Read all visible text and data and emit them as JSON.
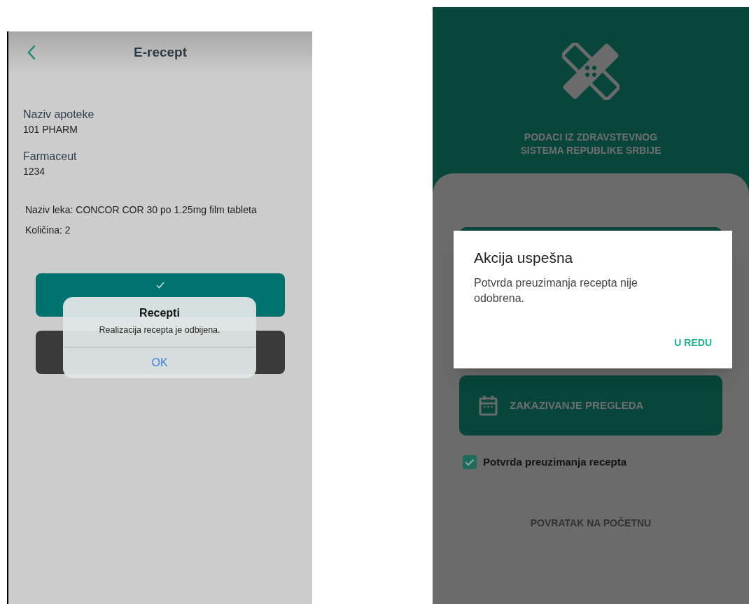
{
  "left_screen": {
    "header": {
      "title": "E-recept"
    },
    "fields": [
      {
        "label": "Naziv apoteke",
        "value": "101 PHARM"
      },
      {
        "label": "Farmaceut",
        "value": "1234"
      }
    ],
    "medication": [
      "Naziv leka: CONCOR COR 30 po 1.25mg film tableta",
      "Količina: 2"
    ],
    "buttons": [
      {
        "kind": "primary"
      },
      {
        "kind": "secondary"
      }
    ],
    "alert": {
      "title": "Recepti",
      "message": "Realizacija recepta je odbijena.",
      "button": "OK"
    }
  },
  "right_screen": {
    "header_text": "PODACI IZ ZDRAVSTEVNOG SISTEMA REPUBLIKE SRBIJE",
    "appointment_button": "ZAKAZIVANJE PREGLEDA",
    "checkbox": {
      "label": "Potvrda preuzimanja recepta",
      "checked": true
    },
    "back_link": "POVRATAK NA POČETNU",
    "dialog": {
      "title": "Akcija uspešna",
      "message": "Potvrda preuzimanja recepta nije odobrena.",
      "button": "U REDU"
    }
  }
}
